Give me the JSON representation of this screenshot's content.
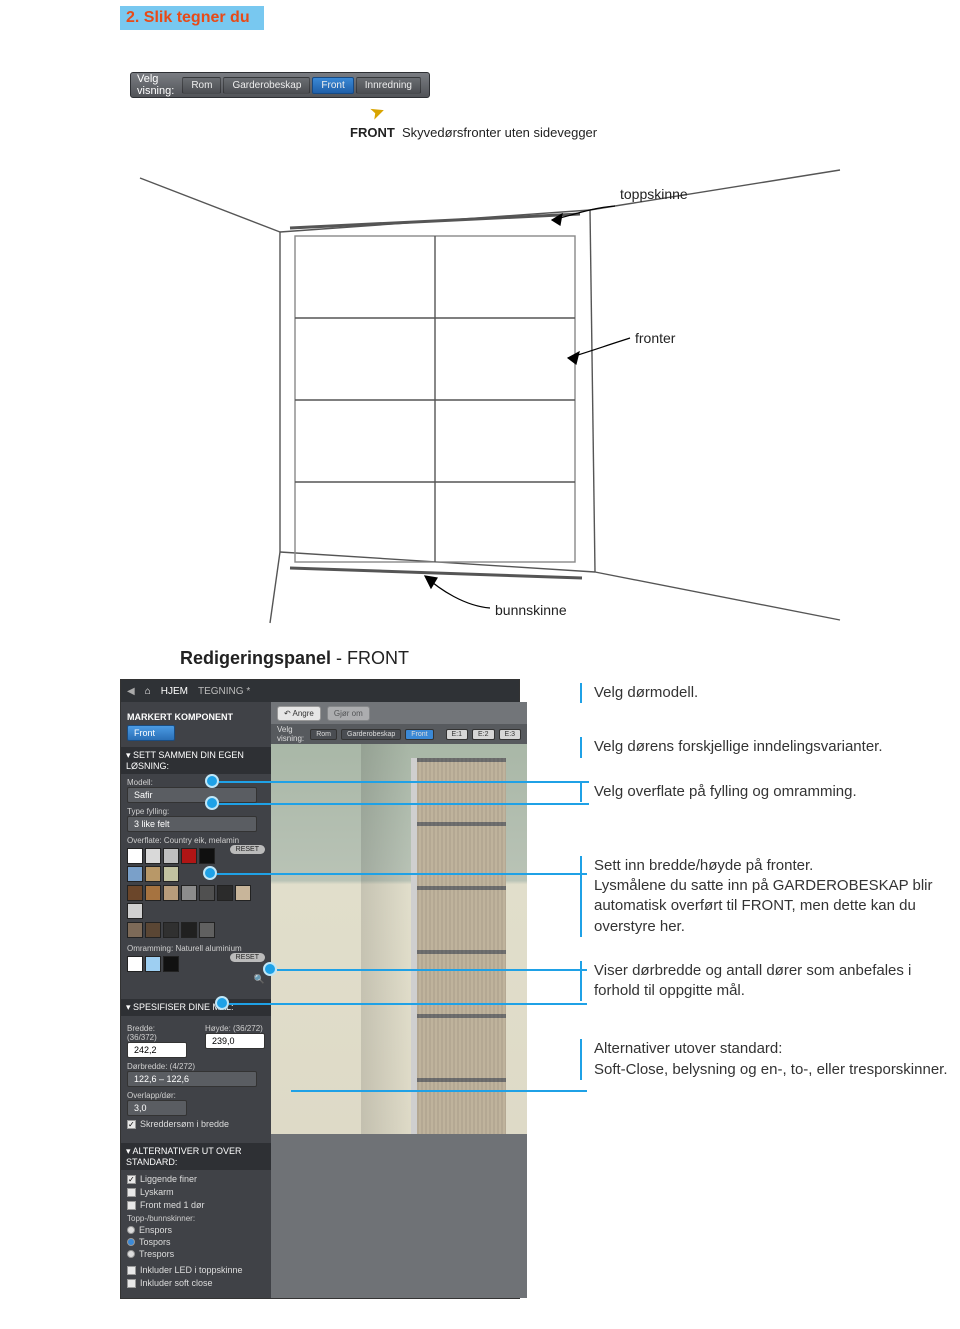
{
  "header": {
    "title": "2. Slik tegner du"
  },
  "toolbar": {
    "label": "Velg visning:",
    "btn_rom": "Rom",
    "btn_garderobe": "Garderobeskap",
    "btn_front": "Front",
    "btn_innredning": "Innredning",
    "note_bold": "FRONT",
    "note_rest": "Skyvedørsfronter uten sidevegger"
  },
  "diagram": {
    "label_topp": "toppskinne",
    "label_fronter": "fronter",
    "label_bunn": "bunnskinne"
  },
  "section": {
    "title_bold": "Redigeringspanel",
    "title_rest": " - FRONT"
  },
  "panel": {
    "tabs": {
      "home_icon": "⌂",
      "home": "HJEM",
      "drawing": "TEGNING *"
    },
    "markert": {
      "heading": "MARKERT KOMPONENT",
      "value": "Front"
    },
    "losning": {
      "acc": "▾  SETT SAMMEN DIN EGEN LØSNING:",
      "l_modell": "Modell:",
      "v_modell": "Safir",
      "l_type": "Type fylling:",
      "v_type": "3 like felt",
      "l_overflate": "Overflate: Country eik, melamin",
      "reset": "RESET",
      "l_omr": "Omramming: Naturell aluminium",
      "sw1": [
        "#ffffff",
        "#d9d9d9",
        "#bfbfbf",
        "#b01515",
        "#101010",
        "#7aa0c9",
        "#b89868",
        "#c2c2a0"
      ],
      "sw2": [
        "#6b462a",
        "#a67340",
        "#b79c7b",
        "#8c8c8c",
        "#505050",
        "#2b2b2b",
        "#c8b59a",
        "#d0d0d0"
      ],
      "sw3": [
        "#7d6a58",
        "#5a4634",
        "#303030",
        "#202020",
        "#606060"
      ],
      "sw_omr": [
        "#ffffff",
        "#9ecff2",
        "#111111"
      ]
    },
    "maal": {
      "acc": "▾  SPESIFISER DINE MÅL:",
      "l_bredde": "Bredde:  (36/372)",
      "v_bredde": "242,2",
      "l_hoyde": "Høyde:  (36/272)",
      "v_hoyde": "239,0",
      "l_dorbredde": "Dørbredde:  (4/272)",
      "v_dorbredde": "122,6 – 122,6",
      "l_overlapp": "Overlapp/dør:",
      "v_overlapp": "3,0",
      "chk_skredder": "Skreddersøm i bredde"
    },
    "alt": {
      "acc": "▾  ALTERNATIVER UT OVER STANDARD:",
      "c1": "Liggende finer",
      "c2": "Lyskarm",
      "c3": "Front med 1 dør",
      "l_spor": "Topp-/bunnskinner:",
      "r1": "Enspors",
      "r2": "Tospors",
      "r3": "Trespors",
      "c4": "Inkluder LED i toppskinne",
      "c5": "Inkluder soft close"
    },
    "right": {
      "undo": "↶ Angre",
      "redo": "Gjør om",
      "label": "Velg visning:",
      "b_rom": "Rom",
      "b_gk": "Garderobeskap",
      "b_front": "Front",
      "b_e1": "E:1",
      "b_e2": "E:2",
      "b_e3": "E:3"
    }
  },
  "callouts": {
    "c1": "Velg dørmodell.",
    "c2": "Velg dørens forskjellige inndelingsvarianter.",
    "c3": "Velg overflate på fylling og omramming.",
    "c4a": "Sett inn bredde/høyde på fronter.",
    "c4b": "Lysmålene du satte inn på GARDEROBESKAP blir automatisk overført til FRONT, men dette kan du overstyre her.",
    "c5": "Viser dørbredde og antall dører som anbefales i forhold til oppgitte mål.",
    "c6a": "Alternativer utover standard:",
    "c6b": "Soft-Close, belysning og en-, to-, eller tresporskinner."
  }
}
